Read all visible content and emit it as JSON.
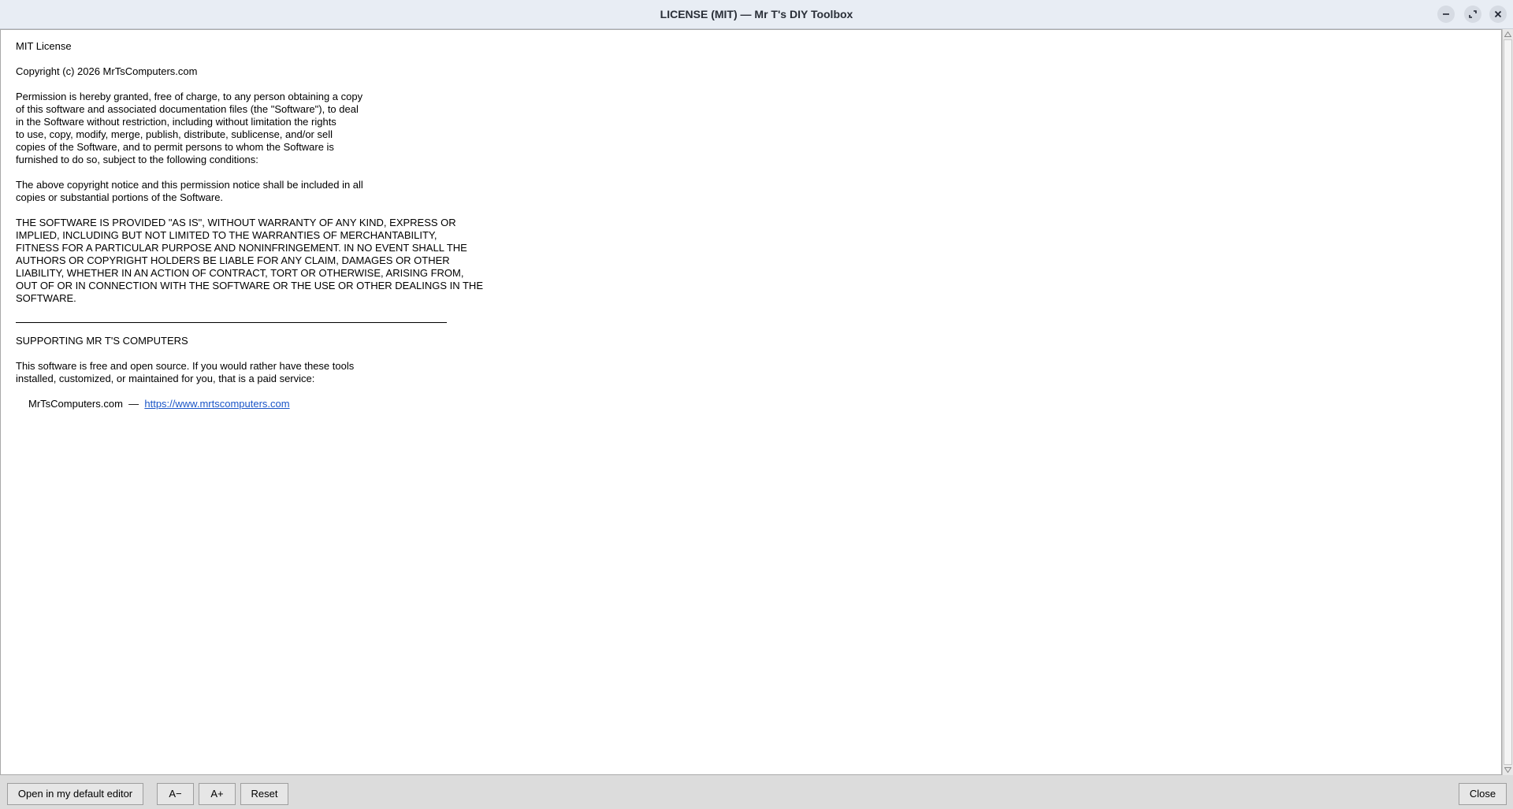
{
  "window": {
    "title": "LICENSE (MIT) — Mr T's DIY Toolbox",
    "controls": {
      "minimize": "minimize-icon",
      "maximize": "maximize-icon",
      "close": "close-icon"
    }
  },
  "license": {
    "heading": "MIT License",
    "copyright": "Copyright (c) 2026 MrTsComputers.com",
    "permission_lines": [
      "Permission is hereby granted, free of charge, to any person obtaining a copy",
      "of this software and associated documentation files (the \"Software\"), to deal",
      "in the Software without restriction, including without limitation the rights",
      "to use, copy, modify, merge, publish, distribute, sublicense, and/or sell",
      "copies of the Software, and to permit persons to whom the Software is",
      "furnished to do so, subject to the following conditions:"
    ],
    "notice_lines": [
      "The above copyright notice and this permission notice shall be included in all",
      "copies or substantial portions of the Software."
    ],
    "warranty_lines": [
      "THE SOFTWARE IS PROVIDED \"AS IS\", WITHOUT WARRANTY OF ANY KIND, EXPRESS OR",
      "IMPLIED, INCLUDING BUT NOT LIMITED TO THE WARRANTIES OF MERCHANTABILITY,",
      "FITNESS FOR A PARTICULAR PURPOSE AND NONINFRINGEMENT. IN NO EVENT SHALL THE",
      "AUTHORS OR COPYRIGHT HOLDERS BE LIABLE FOR ANY CLAIM, DAMAGES OR OTHER",
      "LIABILITY, WHETHER IN AN ACTION OF CONTRACT, TORT OR OTHERWISE, ARISING FROM,",
      "OUT OF OR IN CONNECTION WITH THE SOFTWARE OR THE USE OR OTHER DEALINGS IN THE",
      "SOFTWARE."
    ]
  },
  "supporting": {
    "heading": "SUPPORTING MR T'S COMPUTERS",
    "body_lines": [
      "This software is free and open source. If you would rather have these tools",
      "installed, customized, or maintained for you, that is a paid service:"
    ],
    "site_name": "MrTsComputers.com",
    "separator": "  —  ",
    "link": "https://www.mrtscomputers.com"
  },
  "scrollbar": {
    "up": "arrow-up-icon",
    "down": "arrow-down-icon"
  },
  "toolbar": {
    "open_editor": "Open in my default editor",
    "decrease_font": "A−",
    "increase_font": "A+",
    "reset": "Reset",
    "close": "Close"
  },
  "colors": {
    "titlebar_bg": "#e8edf4",
    "link": "#1a55c7",
    "panel_bg": "#dcdcdc"
  }
}
